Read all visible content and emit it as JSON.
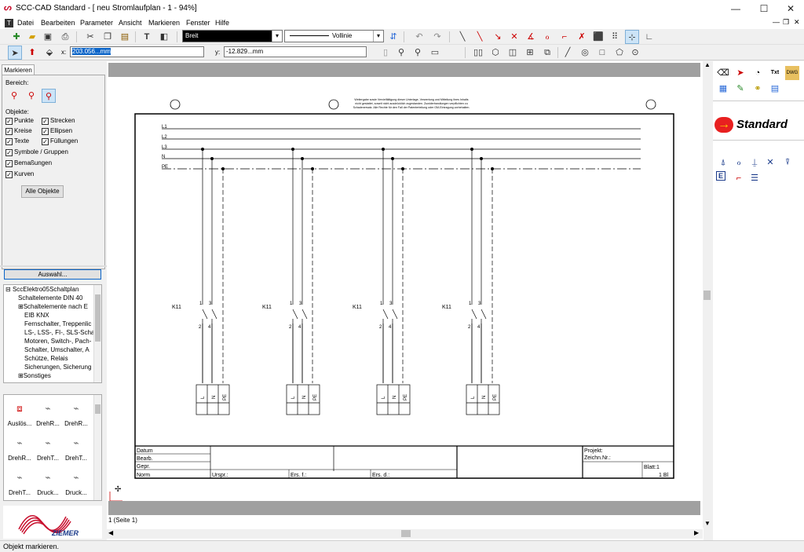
{
  "window": {
    "title": "SCC-CAD Standard - [ neu Stromlaufplan - 1 - 94%]",
    "minimize": "—",
    "maximize": "☐",
    "close": "✕",
    "mdi_min": "—",
    "mdi_restore": "❐",
    "mdi_close": "✕"
  },
  "menu": [
    {
      "label": "Datei"
    },
    {
      "label": "Bearbeiten"
    },
    {
      "label": "Parameter"
    },
    {
      "label": "Ansicht"
    },
    {
      "label": "Markieren"
    },
    {
      "label": "Fenster"
    },
    {
      "label": "Hilfe"
    }
  ],
  "toolbar": {
    "line_width": "Breit",
    "line_style": "Vollinie",
    "x_label": "x:",
    "x_value": "203.056...mm",
    "y_label": "y:",
    "y_value": "-12.829...mm"
  },
  "left_panel": {
    "tab": "Markieren",
    "bereich_label": "Bereich:",
    "objekte_label": "Objekte:",
    "checkboxes": [
      {
        "label": "Punkte",
        "checked": true
      },
      {
        "label": "Strecken",
        "checked": true
      },
      {
        "label": "Kreise",
        "checked": true
      },
      {
        "label": "Ellipsen",
        "checked": true
      },
      {
        "label": "Texte",
        "checked": true
      },
      {
        "label": "Füllungen",
        "checked": true
      },
      {
        "label": "Symbole / Gruppen",
        "checked": true
      },
      {
        "label": "Bemaßungen",
        "checked": true
      },
      {
        "label": "Kurven",
        "checked": true
      }
    ],
    "all_objects_button": "Alle Objekte",
    "auswahl_button": "Auswahl...",
    "tree": [
      "SccElektro05Schaltplan",
      "Schaltelemente DIN 40",
      "Schaltelemente nach E",
      "EIB KNX",
      "Fernschalter, Treppenlic",
      "LS-, LSS-, FI-, SLS-Scha",
      "Motoren, Switch-, Pach-",
      "Schalter, Umschalter, A",
      "Schütze, Relais",
      "Sicherungen, Sicherung",
      "Sonstiges"
    ],
    "symbols": [
      "Auslös...",
      "DrehR...",
      "DrehR...",
      "DrehR...",
      "DrehT...",
      "DrehT...",
      "DrehT...",
      "Druck...",
      "Druck..."
    ],
    "logo_text": "ZIEMER"
  },
  "drawing": {
    "notice_lines": [
      "Weitergabe sowie Vervielfältigung dieser Unterlage, Verwertung und Mitteilung ihres Inhalts",
      "nicht gestattet, soweit nicht ausdrücklich zugestanden. Zuwiderhandlungen verpflichten zu",
      "Schadenersatz. Alle Rechte für den Fall der Patenterteilung oder GM-Eintragung vorbehalten."
    ],
    "buses": [
      "L1",
      "L2",
      "L3",
      "N",
      "PE"
    ],
    "device_label": "K11",
    "terminal_top": [
      "1",
      "3"
    ],
    "terminal_bottom": [
      "2",
      "4"
    ],
    "terminal_labels": [
      "L",
      "N",
      "PE"
    ],
    "titleblock": {
      "datum": "Datum",
      "bearb": "Bearb.",
      "gepr": "Gepr.",
      "norm": "Norm",
      "urspr": "Urspr.:",
      "ers_f": "Ers. f.:",
      "ers_d": "Ers. d.:",
      "projekt": "Projekt:",
      "zeichn": "Zeichn.Nr.:",
      "blatt": "Blatt:1",
      "bl": "1 Bl"
    }
  },
  "sheet_tab": "1 (Seite 1)",
  "right_panel": {
    "standard_label": "Standard"
  },
  "status": "Objekt markieren."
}
